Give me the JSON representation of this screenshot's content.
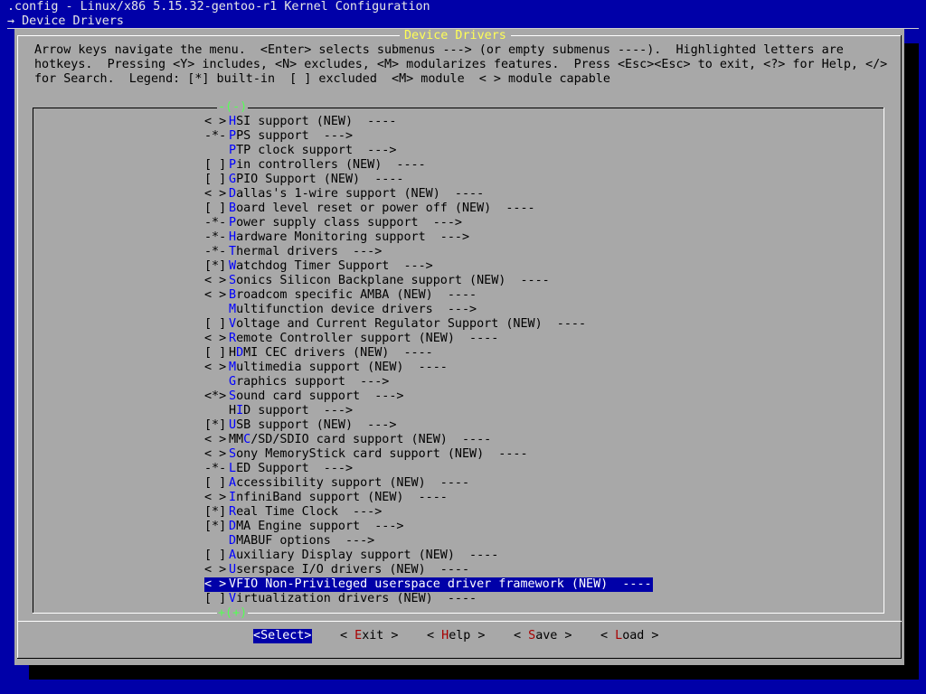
{
  "window": {
    "title": ".config - Linux/x86 5.15.32-gentoo-r1 Kernel Configuration",
    "breadcrumb": "→ Device Drivers"
  },
  "dialog": {
    "title": "Device Drivers",
    "help_lines": [
      "Arrow keys navigate the menu.  <Enter> selects submenus ---> (or empty submenus ----).  Highlighted letters are",
      "hotkeys.  Pressing <Y> includes, <N> excludes, <M> modularizes features.  Press <Esc><Esc> to exit, <?> for Help, </>",
      "for Search.  Legend: [*] built-in  [ ] excluded  <M> module  < > module capable"
    ],
    "scroll_up": "-(-)",
    "scroll_down": "+(+)"
  },
  "menu": {
    "items": [
      {
        "mark": "< >",
        "hotkey": "H",
        "rest": "SI support (NEW)  ----"
      },
      {
        "mark": "-*-",
        "hotkey": "P",
        "rest": "PS support  --->"
      },
      {
        "mark": "",
        "hotkey": "P",
        "rest": "TP clock support  --->"
      },
      {
        "mark": "[ ]",
        "hotkey": "P",
        "rest": "in controllers (NEW)  ----"
      },
      {
        "mark": "[ ]",
        "hotkey": "G",
        "rest": "PIO Support (NEW)  ----"
      },
      {
        "mark": "< >",
        "hotkey": "D",
        "rest": "allas's 1-wire support (NEW)  ----"
      },
      {
        "mark": "[ ]",
        "hotkey": "B",
        "rest": "oard level reset or power off (NEW)  ----"
      },
      {
        "mark": "-*-",
        "hotkey": "P",
        "rest": "ower supply class support  --->"
      },
      {
        "mark": "-*-",
        "hotkey": "H",
        "rest": "ardware Monitoring support  --->"
      },
      {
        "mark": "-*-",
        "hotkey": "T",
        "rest": "hermal drivers  --->"
      },
      {
        "mark": "[*]",
        "hotkey": "W",
        "rest": "atchdog Timer Support  --->"
      },
      {
        "mark": "< >",
        "hotkey": "S",
        "rest": "onics Silicon Backplane support (NEW)  ----"
      },
      {
        "mark": "< >",
        "hotkey": "B",
        "rest": "roadcom specific AMBA (NEW)  ----"
      },
      {
        "mark": "",
        "hotkey": "M",
        "rest": "ultifunction device drivers  --->"
      },
      {
        "mark": "[ ]",
        "hotkey": "V",
        "rest": "oltage and Current Regulator Support (NEW)  ----"
      },
      {
        "mark": "< >",
        "hotkey": "R",
        "rest": "emote Controller support (NEW)  ----"
      },
      {
        "mark": "[ ]",
        "pre": "H",
        "hotkey": "D",
        "rest": "MI CEC drivers (NEW)  ----"
      },
      {
        "mark": "< >",
        "hotkey": "M",
        "rest": "ultimedia support (NEW)  ----"
      },
      {
        "mark": "",
        "hotkey": "G",
        "rest": "raphics support  --->"
      },
      {
        "mark": "<*>",
        "hotkey": "S",
        "rest": "ound card support  --->"
      },
      {
        "mark": "",
        "pre": "H",
        "hotkey": "I",
        "rest": "D support  --->"
      },
      {
        "mark": "[*]",
        "hotkey": "U",
        "rest": "SB support (NEW)  --->"
      },
      {
        "mark": "< >",
        "pre": "MM",
        "hotkey": "C",
        "rest": "/SD/SDIO card support (NEW)  ----"
      },
      {
        "mark": "< >",
        "hotkey": "S",
        "rest": "ony MemoryStick card support (NEW)  ----"
      },
      {
        "mark": "-*-",
        "hotkey": "L",
        "rest": "ED Support  --->"
      },
      {
        "mark": "[ ]",
        "hotkey": "A",
        "rest": "ccessibility support (NEW)  ----"
      },
      {
        "mark": "< >",
        "hotkey": "I",
        "rest": "nfiniBand support (NEW)  ----"
      },
      {
        "mark": "[*]",
        "hotkey": "R",
        "rest": "eal Time Clock  --->"
      },
      {
        "mark": "[*]",
        "hotkey": "D",
        "rest": "MA Engine support  --->"
      },
      {
        "mark": "",
        "hotkey": "D",
        "rest": "MABUF options  --->"
      },
      {
        "mark": "[ ]",
        "hotkey": "A",
        "rest": "uxiliary Display support (NEW)  ----"
      },
      {
        "mark": "< >",
        "hotkey": "U",
        "rest": "serspace I/O drivers (NEW)  ----"
      },
      {
        "mark": "< >",
        "hotkey": "V",
        "rest": "FIO Non-Privileged userspace driver framework (NEW)  ----",
        "selected": true
      },
      {
        "mark": "[ ]",
        "hotkey": "V",
        "rest": "irtualization drivers (NEW)  ----"
      }
    ]
  },
  "buttons": {
    "select": {
      "pre": "<",
      "hotkey": "S",
      "rest": "elect>",
      "selected": true
    },
    "exit": {
      "pre": "< ",
      "hotkey": "E",
      "rest": "xit >"
    },
    "help": {
      "pre": "< ",
      "hotkey": "H",
      "rest": "elp >"
    },
    "save": {
      "pre": "< ",
      "hotkey": "S",
      "rest": "ave >"
    },
    "load": {
      "pre": "< ",
      "hotkey": "L",
      "rest": "oad >"
    }
  },
  "colors": {
    "background": "#0000a8",
    "dialog": "#a8a8a8",
    "dialog_title": "#ffff55",
    "hotkey": "#0000ff",
    "button_hotkey": "#a80000",
    "selection": "#0000a8",
    "scroll_indicator": "#55ff55"
  }
}
